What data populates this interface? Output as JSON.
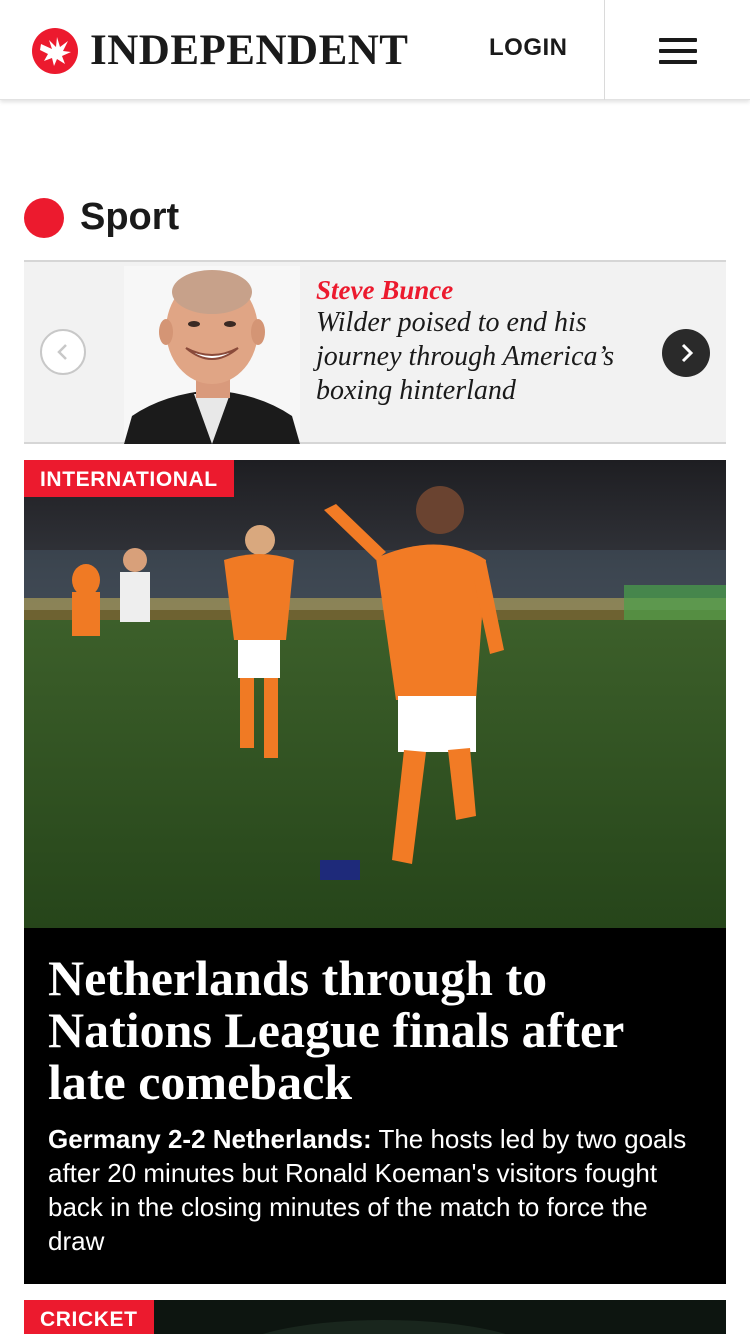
{
  "header": {
    "logo_text": "INDEPENDENT",
    "login_label": "LOGIN",
    "menu_icon": "hamburger-menu-icon",
    "logo_icon": "eagle-logo-icon",
    "brand_color": "#ec1a2e"
  },
  "section": {
    "title": "Sport"
  },
  "carousel": {
    "author": "Steve Bunce",
    "headline": "Wilder poised to end his journey through America’s boxing hinterland",
    "prev_icon": "chevron-left-icon",
    "next_icon": "chevron-right-icon"
  },
  "lead": {
    "tag": "INTERNATIONAL",
    "title": "Netherlands through to Nations League finals after late comeback",
    "standfirst_bold": "Germany 2-2 Netherlands:",
    "standfirst_text": "The hosts led by two goals after 20 minutes but Ronald Koeman's visitors fought back in the closing minutes of the match to force the draw"
  },
  "next": {
    "tag": "CRICKET"
  }
}
